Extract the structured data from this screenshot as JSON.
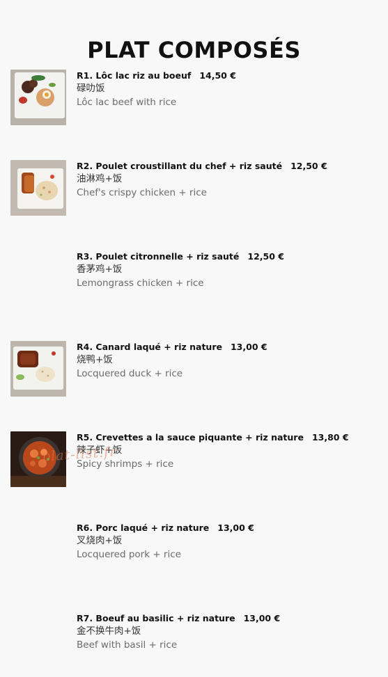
{
  "header": {
    "title": "PLAT COMPOSÉS"
  },
  "items": [
    {
      "name": "R1. Lôc lac riz au boeuf",
      "price": "14,50 €",
      "chinese": "碌叻饭",
      "english": "Lôc lac beef with rice",
      "has_image": true
    },
    {
      "name": "R2. Poulet croustillant du chef + riz sauté",
      "price": "12,50 €",
      "chinese": "油淋鸡+饭",
      "english": "Chef's crispy chicken + rice",
      "has_image": true
    },
    {
      "name": "R3. Poulet citronnelle + riz sauté",
      "price": "12,50 €",
      "chinese": "香茅鸡+饭",
      "english": "Lemongrass chicken + rice",
      "has_image": false
    },
    {
      "name": "R4. Canard laqué + riz nature",
      "price": "13,00 €",
      "chinese": "烧鸭+饭",
      "english": "Locquered duck + rice",
      "has_image": true
    },
    {
      "name": "R5. Crevettes a la sauce piquante + riz nature",
      "price": "13,80 €",
      "chinese": "辣子虾+饭",
      "english": "Spicy shrimps + rice",
      "has_image": true
    },
    {
      "name": "R6. Porc laqué + riz nature",
      "price": "13,00 €",
      "chinese": "叉烧肉+饭",
      "english": "Locquered pork + rice",
      "has_image": false
    },
    {
      "name": "R7. Boeuf au basilic + riz nature",
      "price": "13,00 €",
      "chinese": "金不换牛肉+饭",
      "english": "Beef with basil + rice",
      "has_image": false
    }
  ],
  "watermark": "plat-list.fr",
  "colors": {
    "background": "#f8f8f8",
    "title": "#111111",
    "subtitle": "#6a6a6a"
  }
}
